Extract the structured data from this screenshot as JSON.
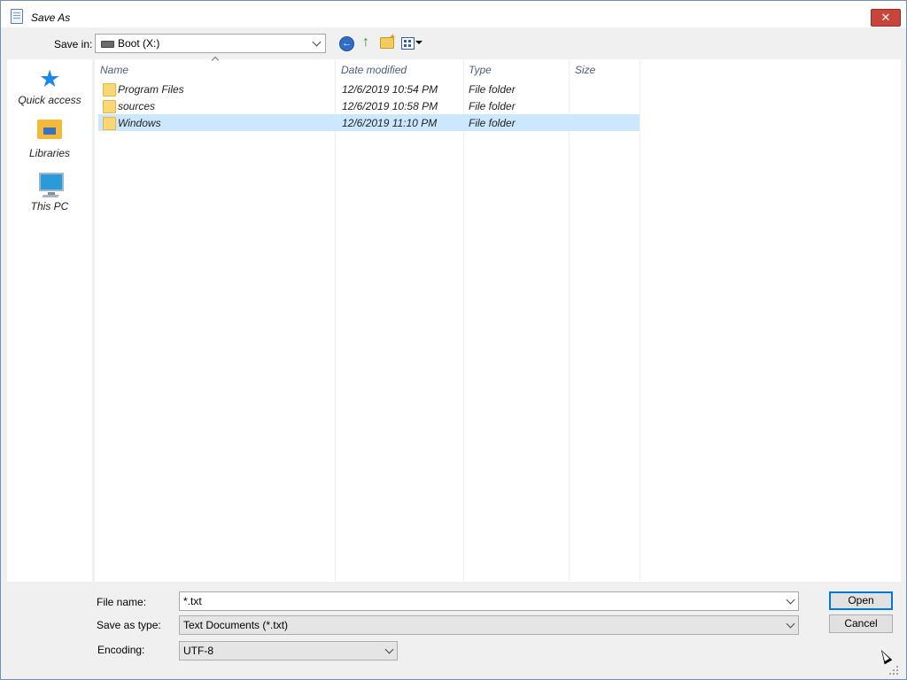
{
  "window": {
    "title": "Save As",
    "close_glyph": "✕"
  },
  "toolbar": {
    "save_in_label": "Save in:",
    "save_in_value": "Boot (X:)",
    "icons": [
      "drive-icon",
      "back-icon",
      "up-folder-icon",
      "new-folder-icon",
      "views-menu-icon"
    ]
  },
  "places": [
    {
      "label": "Quick access",
      "icon": "star-icon"
    },
    {
      "label": "Libraries",
      "icon": "libraries-icon"
    },
    {
      "label": "This PC",
      "icon": "computer-icon"
    }
  ],
  "filelist": {
    "columns": [
      "Name",
      "Date modified",
      "Type",
      "Size"
    ],
    "rows": [
      {
        "name": "Program Files",
        "date": "12/6/2019 10:54 PM",
        "type": "File folder",
        "size": ""
      },
      {
        "name": "sources",
        "date": "12/6/2019 10:58 PM",
        "type": "File folder",
        "size": ""
      },
      {
        "name": "Windows",
        "date": "12/6/2019 11:10 PM",
        "type": "File folder",
        "size": "",
        "selected": true
      }
    ]
  },
  "form": {
    "file_name_label": "File name:",
    "file_name_value": "*.txt",
    "save_as_type_label": "Save as type:",
    "save_as_type_value": "Text Documents (*.txt)",
    "encoding_label": "Encoding:",
    "encoding_value": "UTF-8"
  },
  "buttons": {
    "open": "Open",
    "cancel": "Cancel"
  },
  "colors": {
    "selection": "#cce8ff",
    "close": "#c7463b",
    "accent": "#0078d7"
  }
}
